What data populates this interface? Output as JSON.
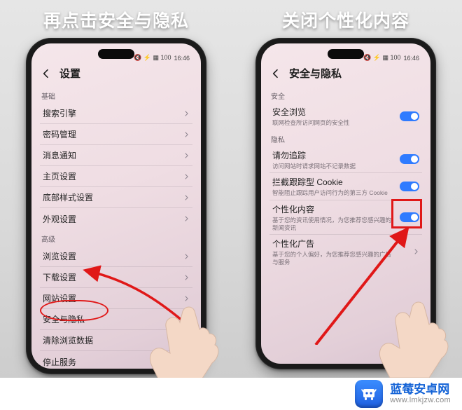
{
  "statusbar": {
    "time": "16:46",
    "icons": "🔇 ⚡ ▦ 100"
  },
  "leftPanel": {
    "instruction": "再点击安全与隐私",
    "title": "设置",
    "sections": [
      {
        "label": "基础",
        "rows": [
          {
            "label": "搜索引擎"
          },
          {
            "label": "密码管理"
          },
          {
            "label": "消息通知"
          },
          {
            "label": "主页设置"
          },
          {
            "label": "底部样式设置"
          },
          {
            "label": "外观设置"
          }
        ]
      },
      {
        "label": "高级",
        "rows": [
          {
            "label": "浏览设置"
          },
          {
            "label": "下载设置"
          },
          {
            "label": "网站设置"
          },
          {
            "label": "安全与隐私"
          },
          {
            "label": "清除浏览数据"
          },
          {
            "label": "停止服务"
          }
        ]
      }
    ]
  },
  "rightPanel": {
    "instruction": "关闭个性化内容",
    "title": "安全与隐私",
    "sections": [
      {
        "label": "安全",
        "rows": [
          {
            "label": "安全浏览",
            "sub": "联网检查所访问网页的安全性",
            "control": "toggle"
          }
        ]
      },
      {
        "label": "隐私",
        "rows": [
          {
            "label": "请勿追踪",
            "sub": "访问网站时请求网站不记录数据",
            "control": "toggle"
          },
          {
            "label": "拦截跟踪型 Cookie",
            "sub": "智能阻止跟踪用户访问行为的第三方 Cookie",
            "control": "toggle"
          },
          {
            "label": "个性化内容",
            "sub": "基于您的资讯使用情况，为您推荐您感兴趣的新闻资讯",
            "control": "toggle"
          },
          {
            "label": "个性化广告",
            "sub": "基于您的个人偏好，为您推荐您感兴趣的广告与服务",
            "control": "chevron"
          }
        ]
      }
    ]
  },
  "footer": {
    "title": "蓝莓安卓网",
    "url": "www.lmkjzw.com"
  }
}
